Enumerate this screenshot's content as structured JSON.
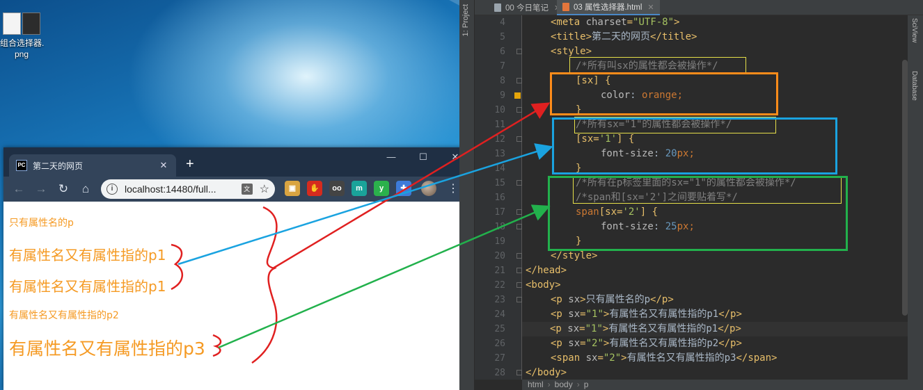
{
  "desktop": {
    "icon_label": "组合选择器.\npng"
  },
  "browser": {
    "tab_favicon": "PC",
    "tab_title": "第二天的网页",
    "tab_close": "✕",
    "new_tab": "+",
    "window": {
      "minimize": "—",
      "maximize": "☐",
      "close": "✕"
    },
    "nav": {
      "back": "←",
      "forward": "→",
      "reload": "↻",
      "home": "⌂"
    },
    "info_icon": "i",
    "url": "localhost:14480/full...",
    "translate": "文",
    "star": "☆",
    "extensions": [
      {
        "name": "image-ext",
        "glyph": "▣",
        "color": "#d9a441"
      },
      {
        "name": "stop-hand-ext",
        "glyph": "✋",
        "color": "#d52b1e"
      },
      {
        "name": "oo-ext",
        "glyph": "oo",
        "color": "#444444"
      },
      {
        "name": "m-ext",
        "glyph": "m",
        "color": "#1aa39a"
      },
      {
        "name": "y-ext",
        "glyph": "y",
        "color": "#2bb14c"
      },
      {
        "name": "puzzle-ext",
        "glyph": "✚",
        "color": "#3d7bd9"
      }
    ],
    "menu": "⋮",
    "paragraphs": [
      {
        "text": "只有属性名的p",
        "size": 14
      },
      {
        "text": "有属性名又有属性指的p1",
        "size": 20
      },
      {
        "text": "有属性名又有属性指的p1",
        "size": 20
      },
      {
        "text": "有属性名又有属性指的p2",
        "size": 14
      },
      {
        "text": "有属性名又有属性指的p3",
        "size": 25
      }
    ],
    "text_color": "#f59a23"
  },
  "ide": {
    "project_tab": "1: Project",
    "tabs": [
      {
        "label": "00 今日笔记",
        "close": "✕"
      },
      {
        "label": "03 属性选择器.html",
        "close": "✕"
      }
    ],
    "right_tabs": [
      "SciView",
      "Database"
    ],
    "status_ok": "✓",
    "line_numbers": [
      "4",
      "5",
      "6",
      "7",
      "8",
      "9",
      "10",
      "11",
      "12",
      "13",
      "14",
      "15",
      "16",
      "17",
      "18",
      "19",
      "20",
      "21",
      "22",
      "23",
      "24",
      "25",
      "26",
      "27",
      "28"
    ],
    "code": {
      "l4": {
        "open": "<meta ",
        "attr": "charset",
        "eq": "=",
        "val": "\"UTF-8\"",
        "close": ">"
      },
      "l5": {
        "open": "<title>",
        "text": "第二天的网页",
        "close": "</title>"
      },
      "l6": {
        "open": "<style>"
      },
      "l7": {
        "comment": "/*所有叫sx的属性都会被操作*/"
      },
      "l8": {
        "selector": "[sx] {"
      },
      "l9": {
        "prop": "color",
        "colon": ": ",
        "value": "orange",
        "semi": ";"
      },
      "l10": {
        "brace": "}"
      },
      "l11": {
        "comment": "/*所有sx=\"1\"的属性都会被操作*/"
      },
      "l12": {
        "sel_a": "[sx=",
        "sel_str": "'1'",
        "sel_b": "] {"
      },
      "l13": {
        "prop": "font-size",
        "colon": ": ",
        "num": "20",
        "unit": "px",
        "semi": ";"
      },
      "l14": {
        "brace": "}"
      },
      "l15": {
        "comment": "/*所有在p标签里面的sx=\"1\"的属性都会被操作*/"
      },
      "l16": {
        "comment": "/*span和[sx='2']之间要贴着写*/"
      },
      "l17": {
        "tag": "span",
        "sel_a": "[sx=",
        "sel_str": "'2'",
        "sel_b": "] {"
      },
      "l18": {
        "prop": "font-size",
        "colon": ": ",
        "num": "25",
        "unit": "px",
        "semi": ";"
      },
      "l19": {
        "brace": "}"
      },
      "l20": {
        "close": "</style>"
      },
      "l21": {
        "close": "</head>"
      },
      "l22": {
        "open": "<body>"
      },
      "l23": {
        "open": "<p ",
        "attr": "sx",
        "close": ">",
        "text": "只有属性名的p",
        "end": "</p>"
      },
      "l24": {
        "open": "<p ",
        "attr": "sx",
        "eq": "=",
        "val": "\"1\"",
        "close": ">",
        "text": "有属性名又有属性指的p1",
        "end": "</p>"
      },
      "l25": {
        "open": "<p ",
        "attr": "sx",
        "eq": "=",
        "val": "\"1\"",
        "close": ">",
        "text": "有属性名又有属性指的p1",
        "end": "</p>"
      },
      "l26": {
        "open": "<p ",
        "attr": "sx",
        "eq": "=",
        "val": "\"2\"",
        "close": ">",
        "text": "有属性名又有属性指的p2",
        "end": "</p>"
      },
      "l27": {
        "open": "<span ",
        "attr": "sx",
        "eq": "=",
        "val": "\"2\"",
        "close": ">",
        "text": "有属性名又有属性指的p3",
        "end": "</span>"
      },
      "l28": {
        "close": "</body>"
      }
    },
    "breadcrumb": [
      "html",
      "body",
      "p"
    ]
  },
  "annotations": {
    "colors": {
      "orange": "#ff8c1a",
      "blue": "#1aa3e0",
      "green": "#22b14c",
      "yellow": "#e6e04a",
      "red": "#e02020"
    }
  }
}
